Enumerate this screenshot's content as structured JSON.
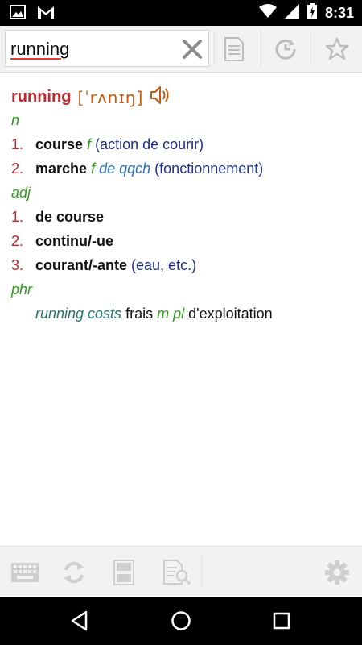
{
  "status_bar": {
    "time": "8:31",
    "icons": [
      "image-icon",
      "gmail-icon",
      "wifi-icon",
      "signal-icon",
      "battery-charging-icon"
    ]
  },
  "toolbar": {
    "search_value": "running",
    "icons": [
      "clear-icon",
      "document-icon",
      "history-icon",
      "star-icon"
    ]
  },
  "entry": {
    "headword": "running",
    "pronunciation": "[ˈrʌnɪŋ]",
    "pos1": "n",
    "senses_n": [
      {
        "num": "1.",
        "translation": "course",
        "gender": "f",
        "note": "(action de courir)",
        "context": ""
      },
      {
        "num": "2.",
        "translation": "marche",
        "gender": "f",
        "context": "de qqch",
        "note": "(fonctionnement)"
      }
    ],
    "pos2": "adj",
    "senses_adj": [
      {
        "num": "1.",
        "translation": "de course",
        "note": ""
      },
      {
        "num": "2.",
        "translation": "continu/-ue",
        "note": ""
      },
      {
        "num": "3.",
        "translation": "courant/-ante",
        "note": "(eau, etc.)"
      }
    ],
    "pos3": "phr",
    "phrase": {
      "source": "running costs",
      "target": "frais",
      "gender": "m pl",
      "rest": "d'exploitation"
    }
  },
  "bottom_bar": {
    "icons": [
      "keyboard-icon",
      "swap-icon",
      "split-view-icon",
      "search-document-icon",
      "settings-icon"
    ]
  },
  "nav_bar": {
    "icons": [
      "back-icon",
      "home-icon",
      "recents-icon"
    ]
  },
  "colors": {
    "headword": "#c0262c",
    "pronunciation": "#c25a12",
    "pos": "#2e9b1a",
    "note": "#1d2f8c",
    "context": "#2d6fb8",
    "phrase": "#1f7a6e"
  }
}
